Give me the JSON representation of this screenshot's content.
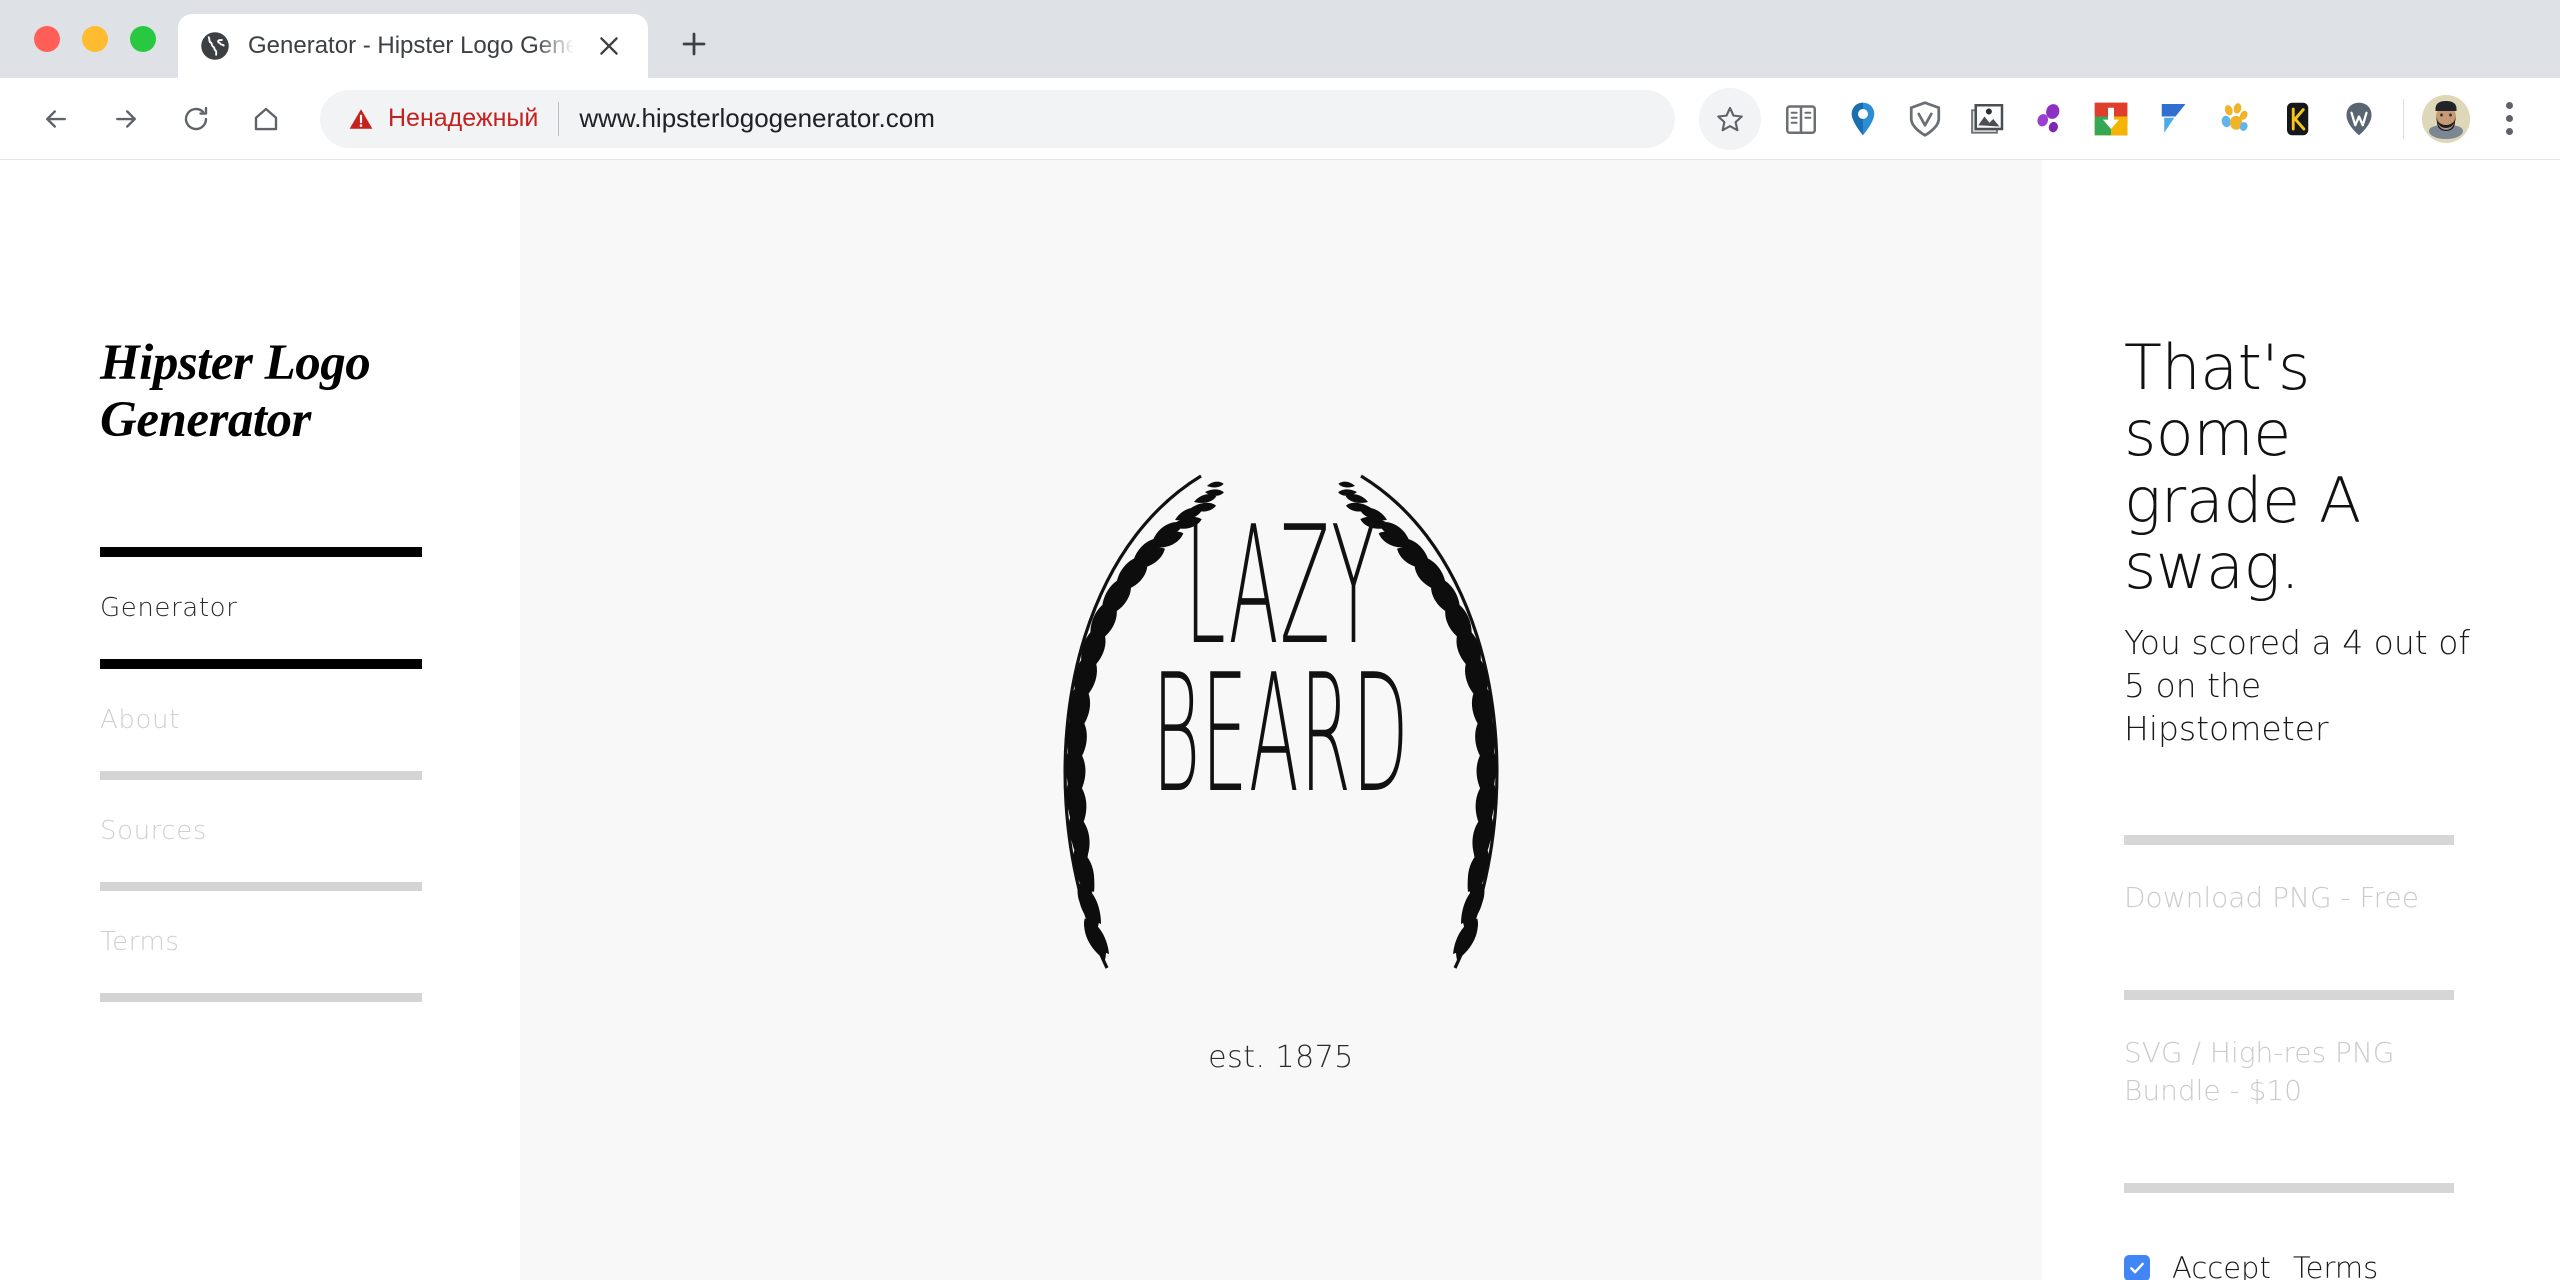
{
  "browser": {
    "window_controls": [
      "close",
      "minimize",
      "maximize"
    ],
    "tab": {
      "title": "Generator - Hipster Logo Gene",
      "favicon": "globe-icon",
      "close": "×"
    },
    "new_tab_label": "+",
    "nav": {
      "back": "back-arrow-icon",
      "forward": "forward-arrow-icon",
      "reload": "reload-icon",
      "home": "home-icon"
    },
    "omnibox": {
      "security_icon": "warning-triangle-icon",
      "security_label": "Ненадежный",
      "url": "www.hipsterlogogenerator.com"
    },
    "bookmark_icon": "star-icon",
    "extensions": [
      "reading-list-icon",
      "location-pin-icon",
      "shield-v-icon",
      "save-image-icon",
      "purple-dots-icon",
      "download-chrome-icon",
      "blue-flag-icon",
      "paw-prints-icon",
      "kami-k-icon",
      "wikiwand-w-icon"
    ],
    "avatar": "user-avatar",
    "menu": "three-dot-menu-icon"
  },
  "sidebar": {
    "brand_line1": "Hipster Logo",
    "brand_line2": "Generator",
    "items": [
      {
        "label": "Generator",
        "active": true
      },
      {
        "label": "About",
        "active": false
      },
      {
        "label": "Sources",
        "active": false
      },
      {
        "label": "Terms",
        "active": false
      }
    ]
  },
  "canvas": {
    "logo": {
      "line1": "LAZY",
      "line2": "BEARD",
      "emblem": "laurel-wreath-icon"
    },
    "established": "est. 1875"
  },
  "right_panel": {
    "headline": "That's some grade A swag.",
    "subline": "You scored a 4 out of 5 on the Hipstometer",
    "download_free": "Download PNG - Free",
    "download_paid": "SVG / High-res PNG Bundle - $10",
    "accept_label": "Accept",
    "terms_link": "Terms",
    "checkbox_checked": true
  },
  "colors": {
    "accent_blue": "#4285f4",
    "warning_red": "#c5221f",
    "chrome_tabstrip": "#dee1e6",
    "canvas_bg": "#f8f8f8",
    "rule_active": "#000000",
    "rule_inactive": "#d4d4d4",
    "text_muted": "#cbcbcb"
  }
}
